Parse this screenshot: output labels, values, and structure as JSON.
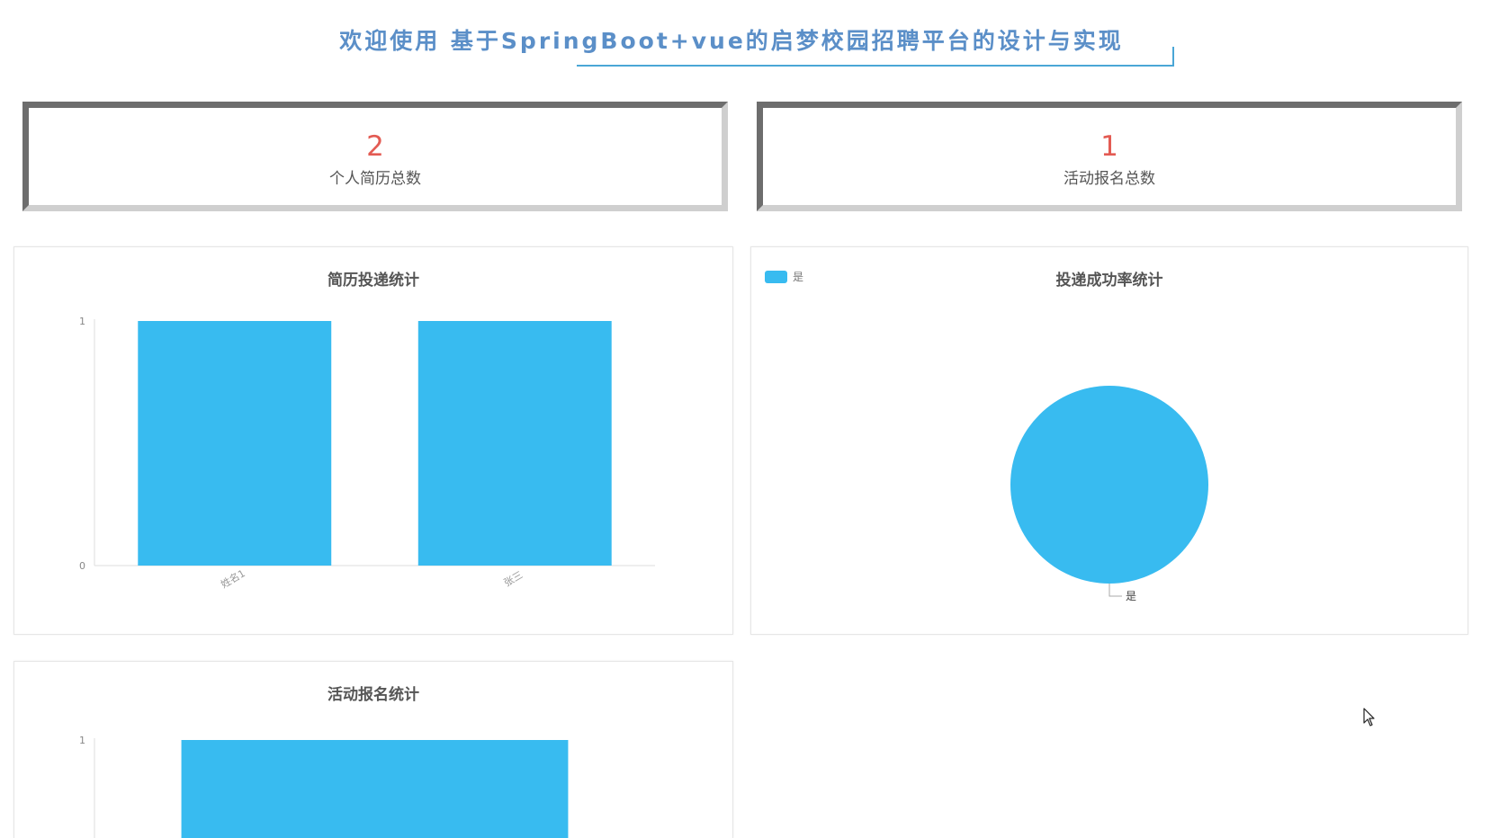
{
  "header": {
    "welcome": "欢迎使用 基于SpringBoot+vue的启梦校园招聘平台的设计与实现"
  },
  "stats": [
    {
      "value": "2",
      "label": "个人简历总数"
    },
    {
      "value": "1",
      "label": "活动报名总数"
    }
  ],
  "colors": {
    "accent": "#38bbf0",
    "title": "#5b8fc8",
    "stat_number": "#e35b53"
  },
  "chart_data": [
    {
      "type": "bar",
      "title": "简历投递统计",
      "categories": [
        "姓名1",
        "张三"
      ],
      "values": [
        1,
        1
      ],
      "ylim": [
        0,
        1
      ],
      "yticks": [
        0,
        1
      ],
      "color": "#38bbf0"
    },
    {
      "type": "pie",
      "title": "投递成功率统计",
      "labels": [
        "是"
      ],
      "values": [
        1
      ],
      "legend": [
        "是"
      ],
      "legend_position": "top-left",
      "color": "#38bbf0"
    },
    {
      "type": "bar",
      "title": "活动报名统计",
      "categories": [
        ""
      ],
      "values": [
        1
      ],
      "ylim": [
        0,
        1
      ],
      "yticks": [
        1
      ],
      "color": "#38bbf0"
    }
  ]
}
